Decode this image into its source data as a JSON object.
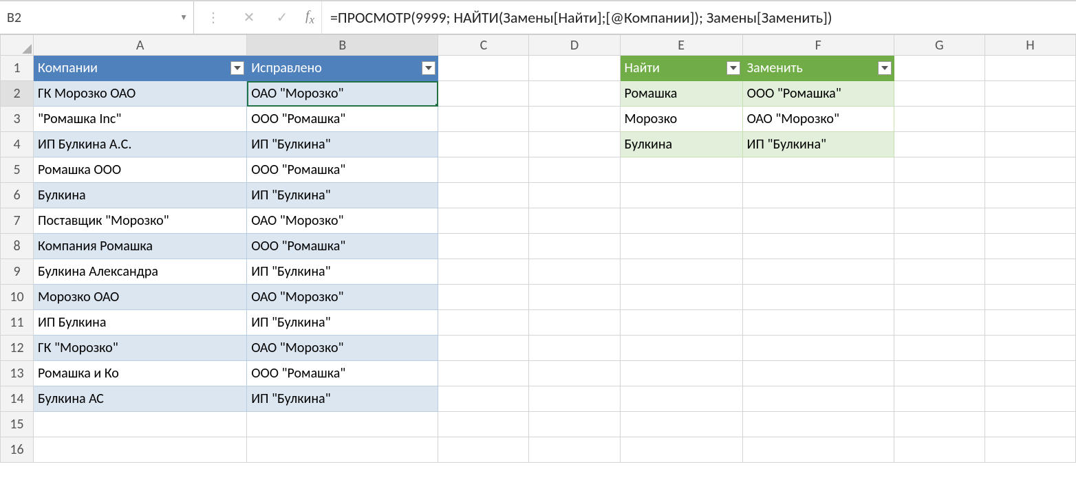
{
  "nameBox": "B2",
  "formula": "=ПРОСМОТР(9999; НАЙТИ(Замены[Найти];[@Компании]); Замены[Заменить])",
  "columns": [
    "A",
    "B",
    "C",
    "D",
    "E",
    "F",
    "G",
    "H"
  ],
  "table1": {
    "headers": [
      "Компании",
      "Исправлено"
    ],
    "rows": [
      [
        "ГК Морозко ОАО",
        "ОАО \"Морозко\""
      ],
      [
        "\"Ромашка Inc\"",
        "ООО \"Ромашка\""
      ],
      [
        "ИП Булкина А.С.",
        "ИП \"Булкина\""
      ],
      [
        "Ромашка ООО",
        "ООО \"Ромашка\""
      ],
      [
        "Булкина",
        "ИП \"Булкина\""
      ],
      [
        "Поставщик \"Морозко\"",
        "ОАО \"Морозко\""
      ],
      [
        "Компания Ромашка",
        "ООО \"Ромашка\""
      ],
      [
        "Булкина Александра",
        "ИП \"Булкина\""
      ],
      [
        "Морозко ОАО",
        "ОАО \"Морозко\""
      ],
      [
        "ИП Булкина",
        "ИП \"Булкина\""
      ],
      [
        "ГК \"Морозко\"",
        "ОАО \"Морозко\""
      ],
      [
        "Ромашка и Ко",
        "ООО \"Ромашка\""
      ],
      [
        "Булкина АС",
        "ИП \"Булкина\""
      ]
    ]
  },
  "table2": {
    "headers": [
      "Найти",
      "Заменить"
    ],
    "rows": [
      [
        "Ромашка",
        "ООО \"Ромашка\""
      ],
      [
        "Морозко",
        "ОАО \"Морозко\""
      ],
      [
        "Булкина",
        "ИП \"Булкина\""
      ]
    ]
  },
  "selectedCell": "B2"
}
